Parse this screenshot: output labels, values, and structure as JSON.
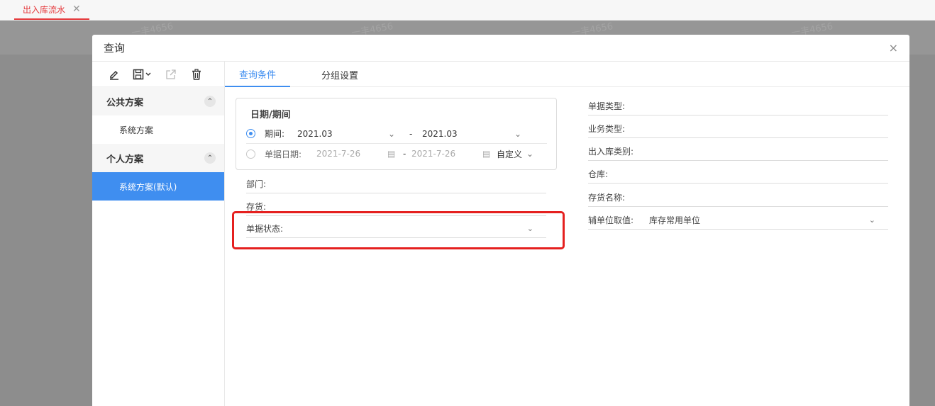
{
  "topbar": {
    "tab_label": "出入库流水",
    "close_icon": "close-icon"
  },
  "watermarks": [
    "一丰4656",
    "一丰4656",
    "一丰4656",
    "一丰4656"
  ],
  "dialog": {
    "title": "查询",
    "close_glyph": "×"
  },
  "toolbar": {
    "icons": [
      "edit-icon",
      "save-icon",
      "export-icon",
      "delete-icon"
    ]
  },
  "plans": {
    "public_group": "公共方案",
    "public_items": [
      "系统方案"
    ],
    "personal_group": "个人方案",
    "personal_items": [
      "系统方案(默认)"
    ]
  },
  "tabs": [
    "查询条件",
    "分组设置"
  ],
  "date_section": {
    "title": "日期/期间",
    "period_label": "期间:",
    "period_from": "2021.03",
    "separator": "-",
    "period_to": "2021.03",
    "date_label": "单据日期:",
    "date_from": "2021-7-26",
    "date_to": "2021-7-26",
    "custom_label": "自定义"
  },
  "left_fields": {
    "dept": "部门:",
    "inventory": "存货:",
    "doc_status": "单据状态:"
  },
  "right_fields": {
    "doc_type": "单据类型:",
    "biz_type": "业务类型:",
    "io_category": "出入库类别:",
    "warehouse": "仓库:",
    "inventory_name": "存货名称:",
    "aux_unit_label": "辅单位取值:",
    "aux_unit_value": "库存常用单位"
  },
  "colors": {
    "accent": "#3f8ef0",
    "tab_red": "#e5393c",
    "highlight": "#e5201f"
  }
}
